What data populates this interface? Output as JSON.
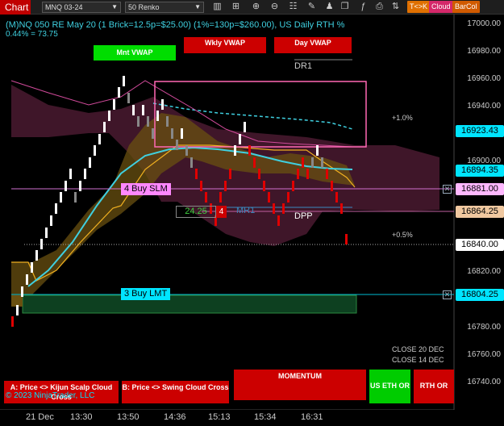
{
  "toolbar": {
    "chart_label": "Chart",
    "instrument": "MNQ 03-24",
    "bar_type": "50 Renko",
    "tk_label": "T<>K",
    "cloud_label": "Cloud",
    "barcol_label": "BarCol"
  },
  "chart": {
    "title": "(M)NQ 050 RE May 20 (1 Brick=12.5p=$25.00) (1%=130p=$260.00), US Daily RTH %",
    "subtitle": "0.44% = 73.75",
    "mnt_vwap": "Mnt VWAP",
    "wkly_vwap": "Wkly VWAP",
    "day_vwap": "Day VWAP",
    "dr1": "DR1",
    "mr1": "MR1",
    "dpp": "DPP",
    "pct_up": "+1.0%",
    "pct_mid": "+0.5%",
    "close_20": "CLOSE 20 DEC",
    "close_14": "CLOSE 14 DEC",
    "copyright": "© 2023 NinjaTrader, LLC",
    "counter_value": "24.25",
    "counter_qty": "4"
  },
  "orders": {
    "buy_slm": "4 Buy SLM",
    "buy_lmt": "3 Buy LMT"
  },
  "price_axis": {
    "ticks": [
      "17000.00",
      "16980.00",
      "16960.00",
      "16940.00",
      "16920.00",
      "16900.00",
      "16880.00",
      "16860.00",
      "16840.00",
      "16820.00",
      "16800.00",
      "16780.00",
      "16760.00",
      "16740.00"
    ],
    "tags": {
      "tag_1": "16923.43",
      "tag_2": "16894.35",
      "tag_3": "16881.00",
      "tag_4": "16864.25",
      "tag_5": "16840.00",
      "tag_6": "16804.25"
    }
  },
  "time_axis": [
    "21 Dec",
    "13:30",
    "13:50",
    "14:36",
    "15:13",
    "15:34",
    "16:31"
  ],
  "bottom_panel": {
    "a_label": "A: Price <> Kijun Scalp Cloud Cross",
    "b_label": "B: Price <> Swing Cloud Cross",
    "momentum": "MOMENTUM",
    "us_eth_or": "US ETH OR",
    "rth_or": "RTH OR"
  },
  "colors": {
    "tenkan": "#3fd0e0",
    "kijun": "#f0b020",
    "cloud_bear": "#4a1a30",
    "cloud_bull": "#6a5010",
    "vwap_box": "#ff69b4",
    "buy_slm": "#ff88ff",
    "buy_lmt": "#00e5ff",
    "brick_up": "#ffffff",
    "brick_down": "#e00000"
  }
}
